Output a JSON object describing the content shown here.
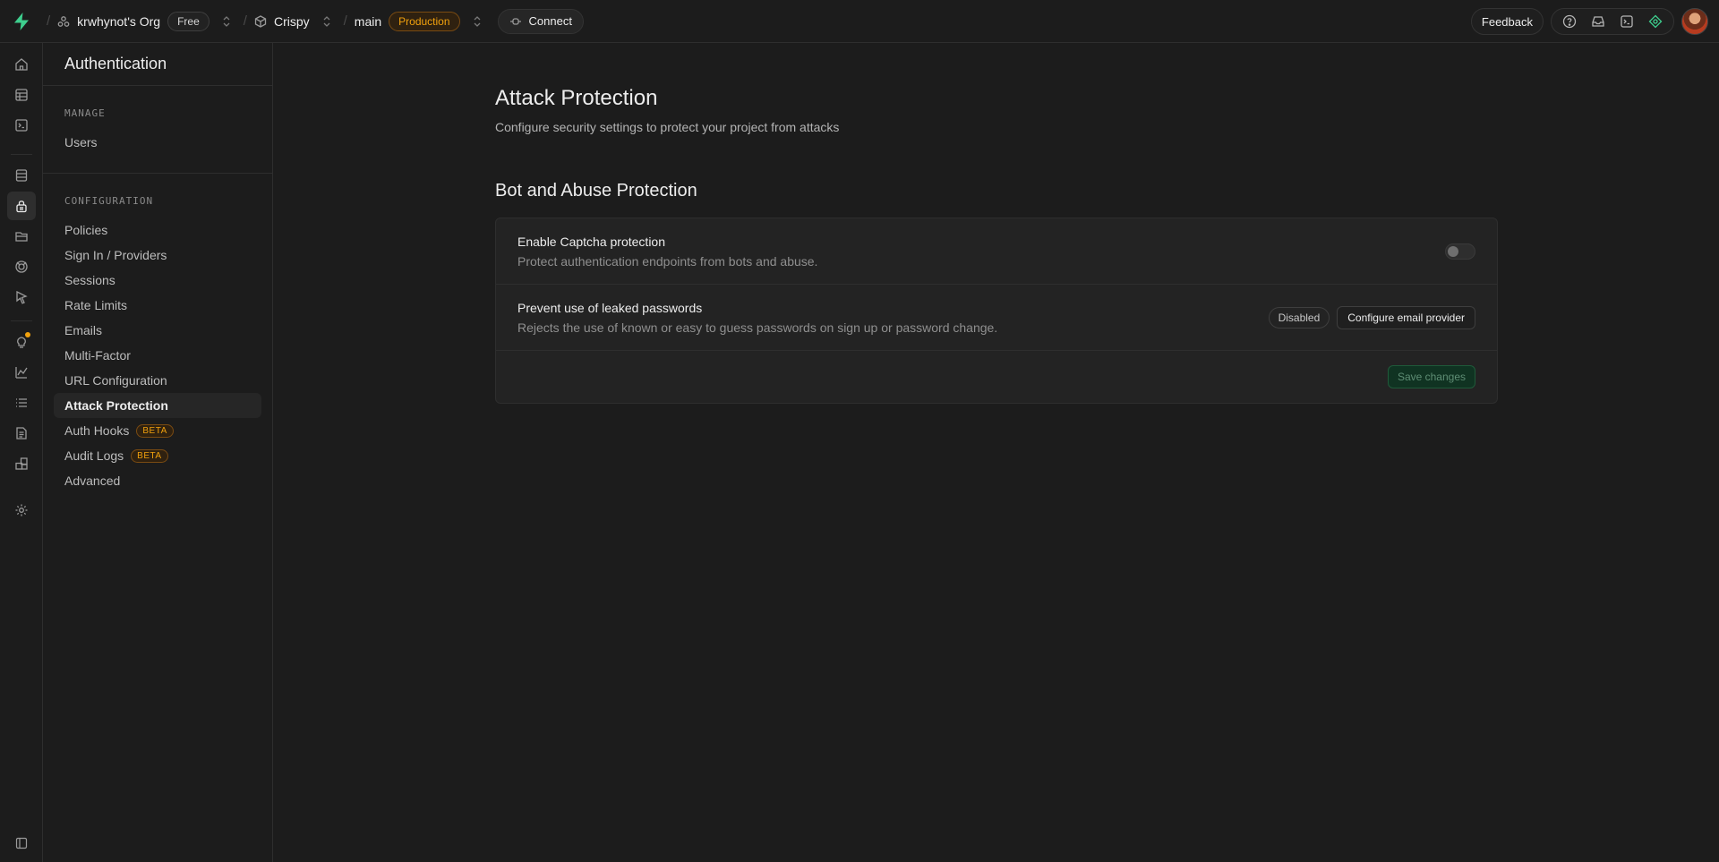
{
  "topbar": {
    "org_name": "krwhynot's Org",
    "org_plan": "Free",
    "project_name": "Crispy",
    "branch_name": "main",
    "branch_env": "Production",
    "connect_label": "Connect",
    "feedback_label": "Feedback"
  },
  "sidebar": {
    "title": "Authentication",
    "manage_label": "MANAGE",
    "manage_items": [
      {
        "label": "Users"
      }
    ],
    "config_label": "CONFIGURATION",
    "config_items": [
      {
        "label": "Policies"
      },
      {
        "label": "Sign In / Providers"
      },
      {
        "label": "Sessions"
      },
      {
        "label": "Rate Limits"
      },
      {
        "label": "Emails"
      },
      {
        "label": "Multi-Factor"
      },
      {
        "label": "URL Configuration"
      },
      {
        "label": "Attack Protection"
      },
      {
        "label": "Auth Hooks",
        "badge": "BETA"
      },
      {
        "label": "Audit Logs",
        "badge": "BETA"
      },
      {
        "label": "Advanced"
      }
    ]
  },
  "main": {
    "title": "Attack Protection",
    "subtitle": "Configure security settings to protect your project from attacks",
    "section_title": "Bot and Abuse Protection",
    "captcha": {
      "label": "Enable Captcha protection",
      "description": "Protect authentication endpoints from bots and abuse.",
      "enabled": false
    },
    "leaked": {
      "label": "Prevent use of leaked passwords",
      "description": "Rejects the use of known or easy to guess passwords on sign up or password change.",
      "status": "Disabled",
      "configure_label": "Configure email provider"
    },
    "save_label": "Save changes"
  },
  "colors": {
    "accent_green": "#3ecf8e",
    "warning_orange": "#f1a10d",
    "background": "#1c1c1c"
  }
}
